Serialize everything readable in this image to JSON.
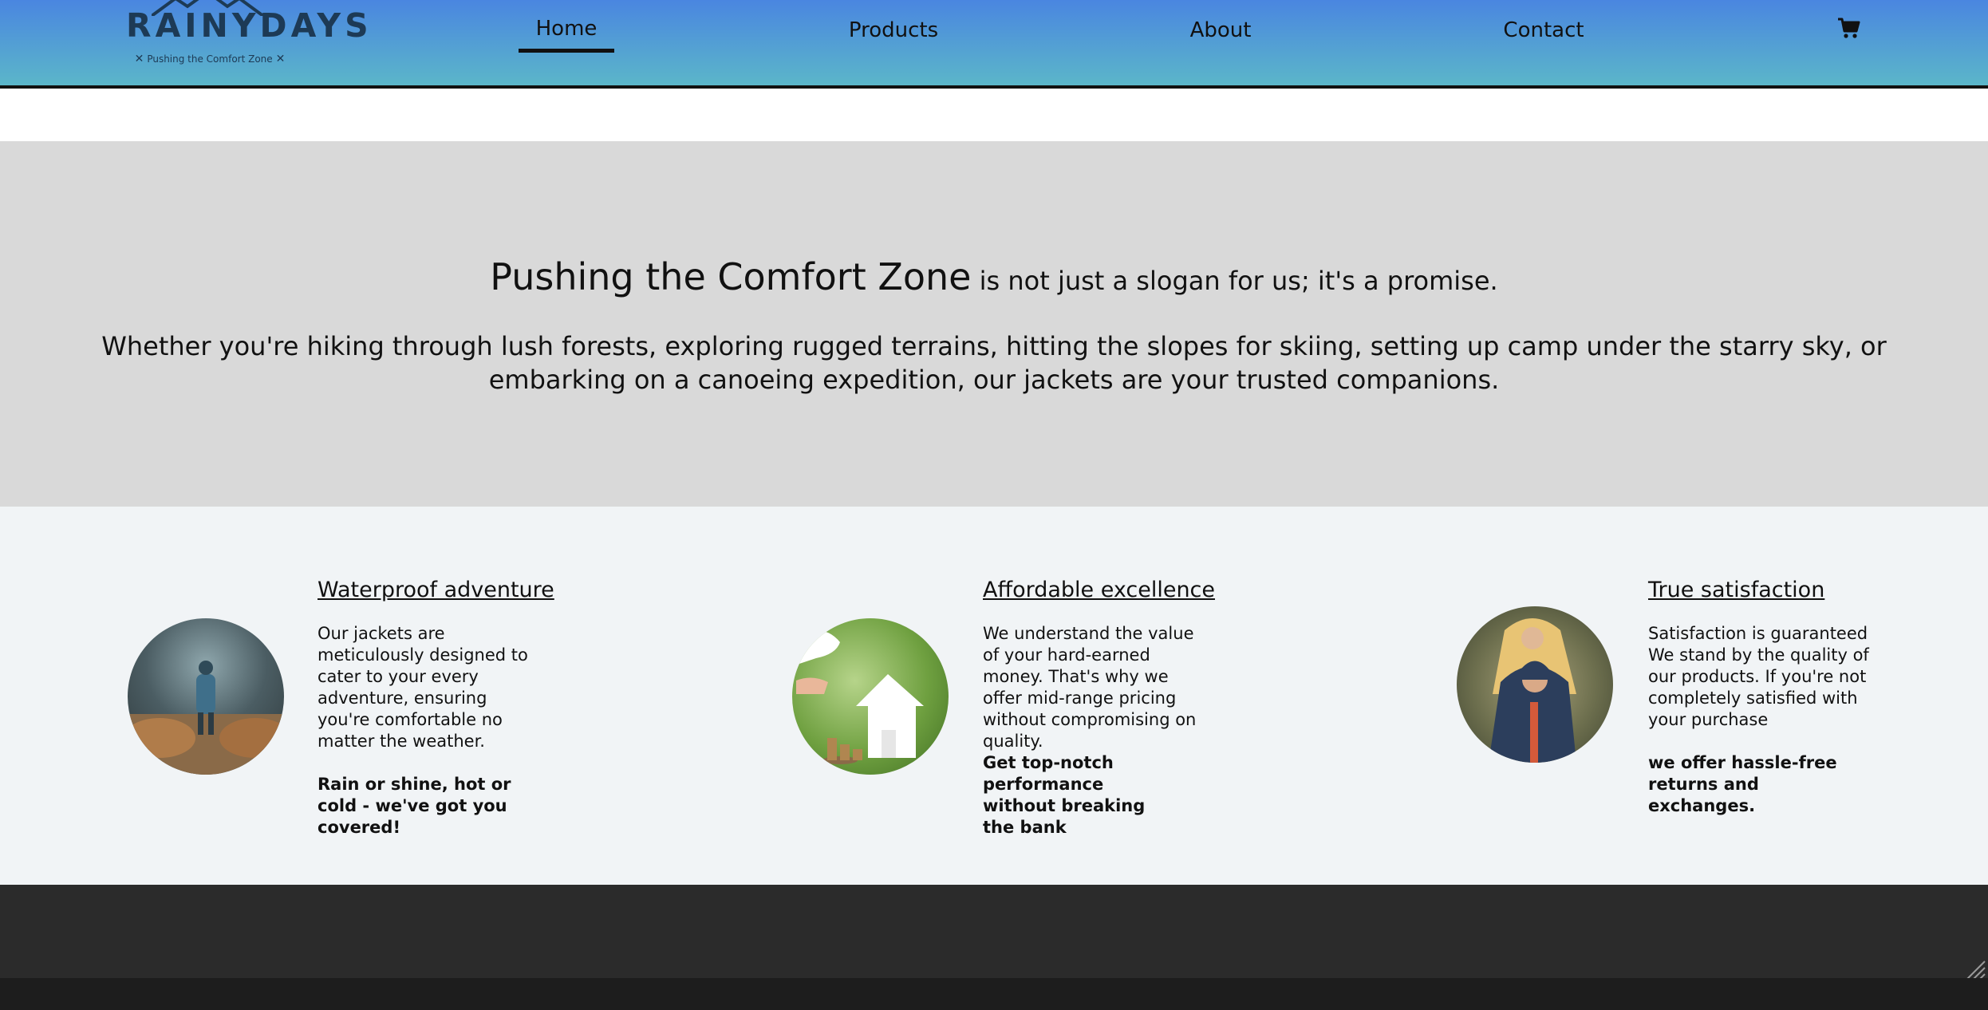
{
  "brand": {
    "name": "RAINYDAYS",
    "tagline": "Pushing the Comfort Zone",
    "tagline_mark": "✕"
  },
  "nav": {
    "items": [
      {
        "label": "Home",
        "active": true
      },
      {
        "label": "Products",
        "active": false
      },
      {
        "label": "About",
        "active": false
      },
      {
        "label": "Contact",
        "active": false
      }
    ],
    "cart_icon": "shopping-cart-icon"
  },
  "hero": {
    "highlight": "Pushing the Comfort Zone",
    "line1_rest": " is not just a slogan for us; it's a promise.",
    "line2": "Whether you're hiking through lush forests, exploring rugged terrains, hitting the slopes for skiing, setting up camp under the starry sky, or embarking on a canoeing expedition, our jackets are your trusted companions."
  },
  "features": [
    {
      "title": "Waterproof adventure",
      "body": "Our jackets are meticulously designed to cater to your every adventure, ensuring you're comfortable no matter the weather.",
      "strong": "Rain or shine, hot or cold - we've got you covered!"
    },
    {
      "title": "Affordable excellence",
      "body": "We understand the value of your hard-earned money. That's why we offer mid-range pricing without compromising on quality.",
      "strong": "Get top-notch performance without breaking the bank"
    },
    {
      "title": "True satisfaction",
      "body": "Satisfaction is guaranteed We stand by the quality of our products. If you're not completely satisfied with your purchase",
      "strong": "we offer hassle-free returns and exchanges."
    }
  ],
  "colors": {
    "header_top": "#4a86e0",
    "header_bottom": "#5bb6c9",
    "hero_bg": "#d9d9d9",
    "features_bg": "#f1f4f6",
    "footer_bg": "#2b2b2b",
    "logo_text": "#1d3a55"
  }
}
